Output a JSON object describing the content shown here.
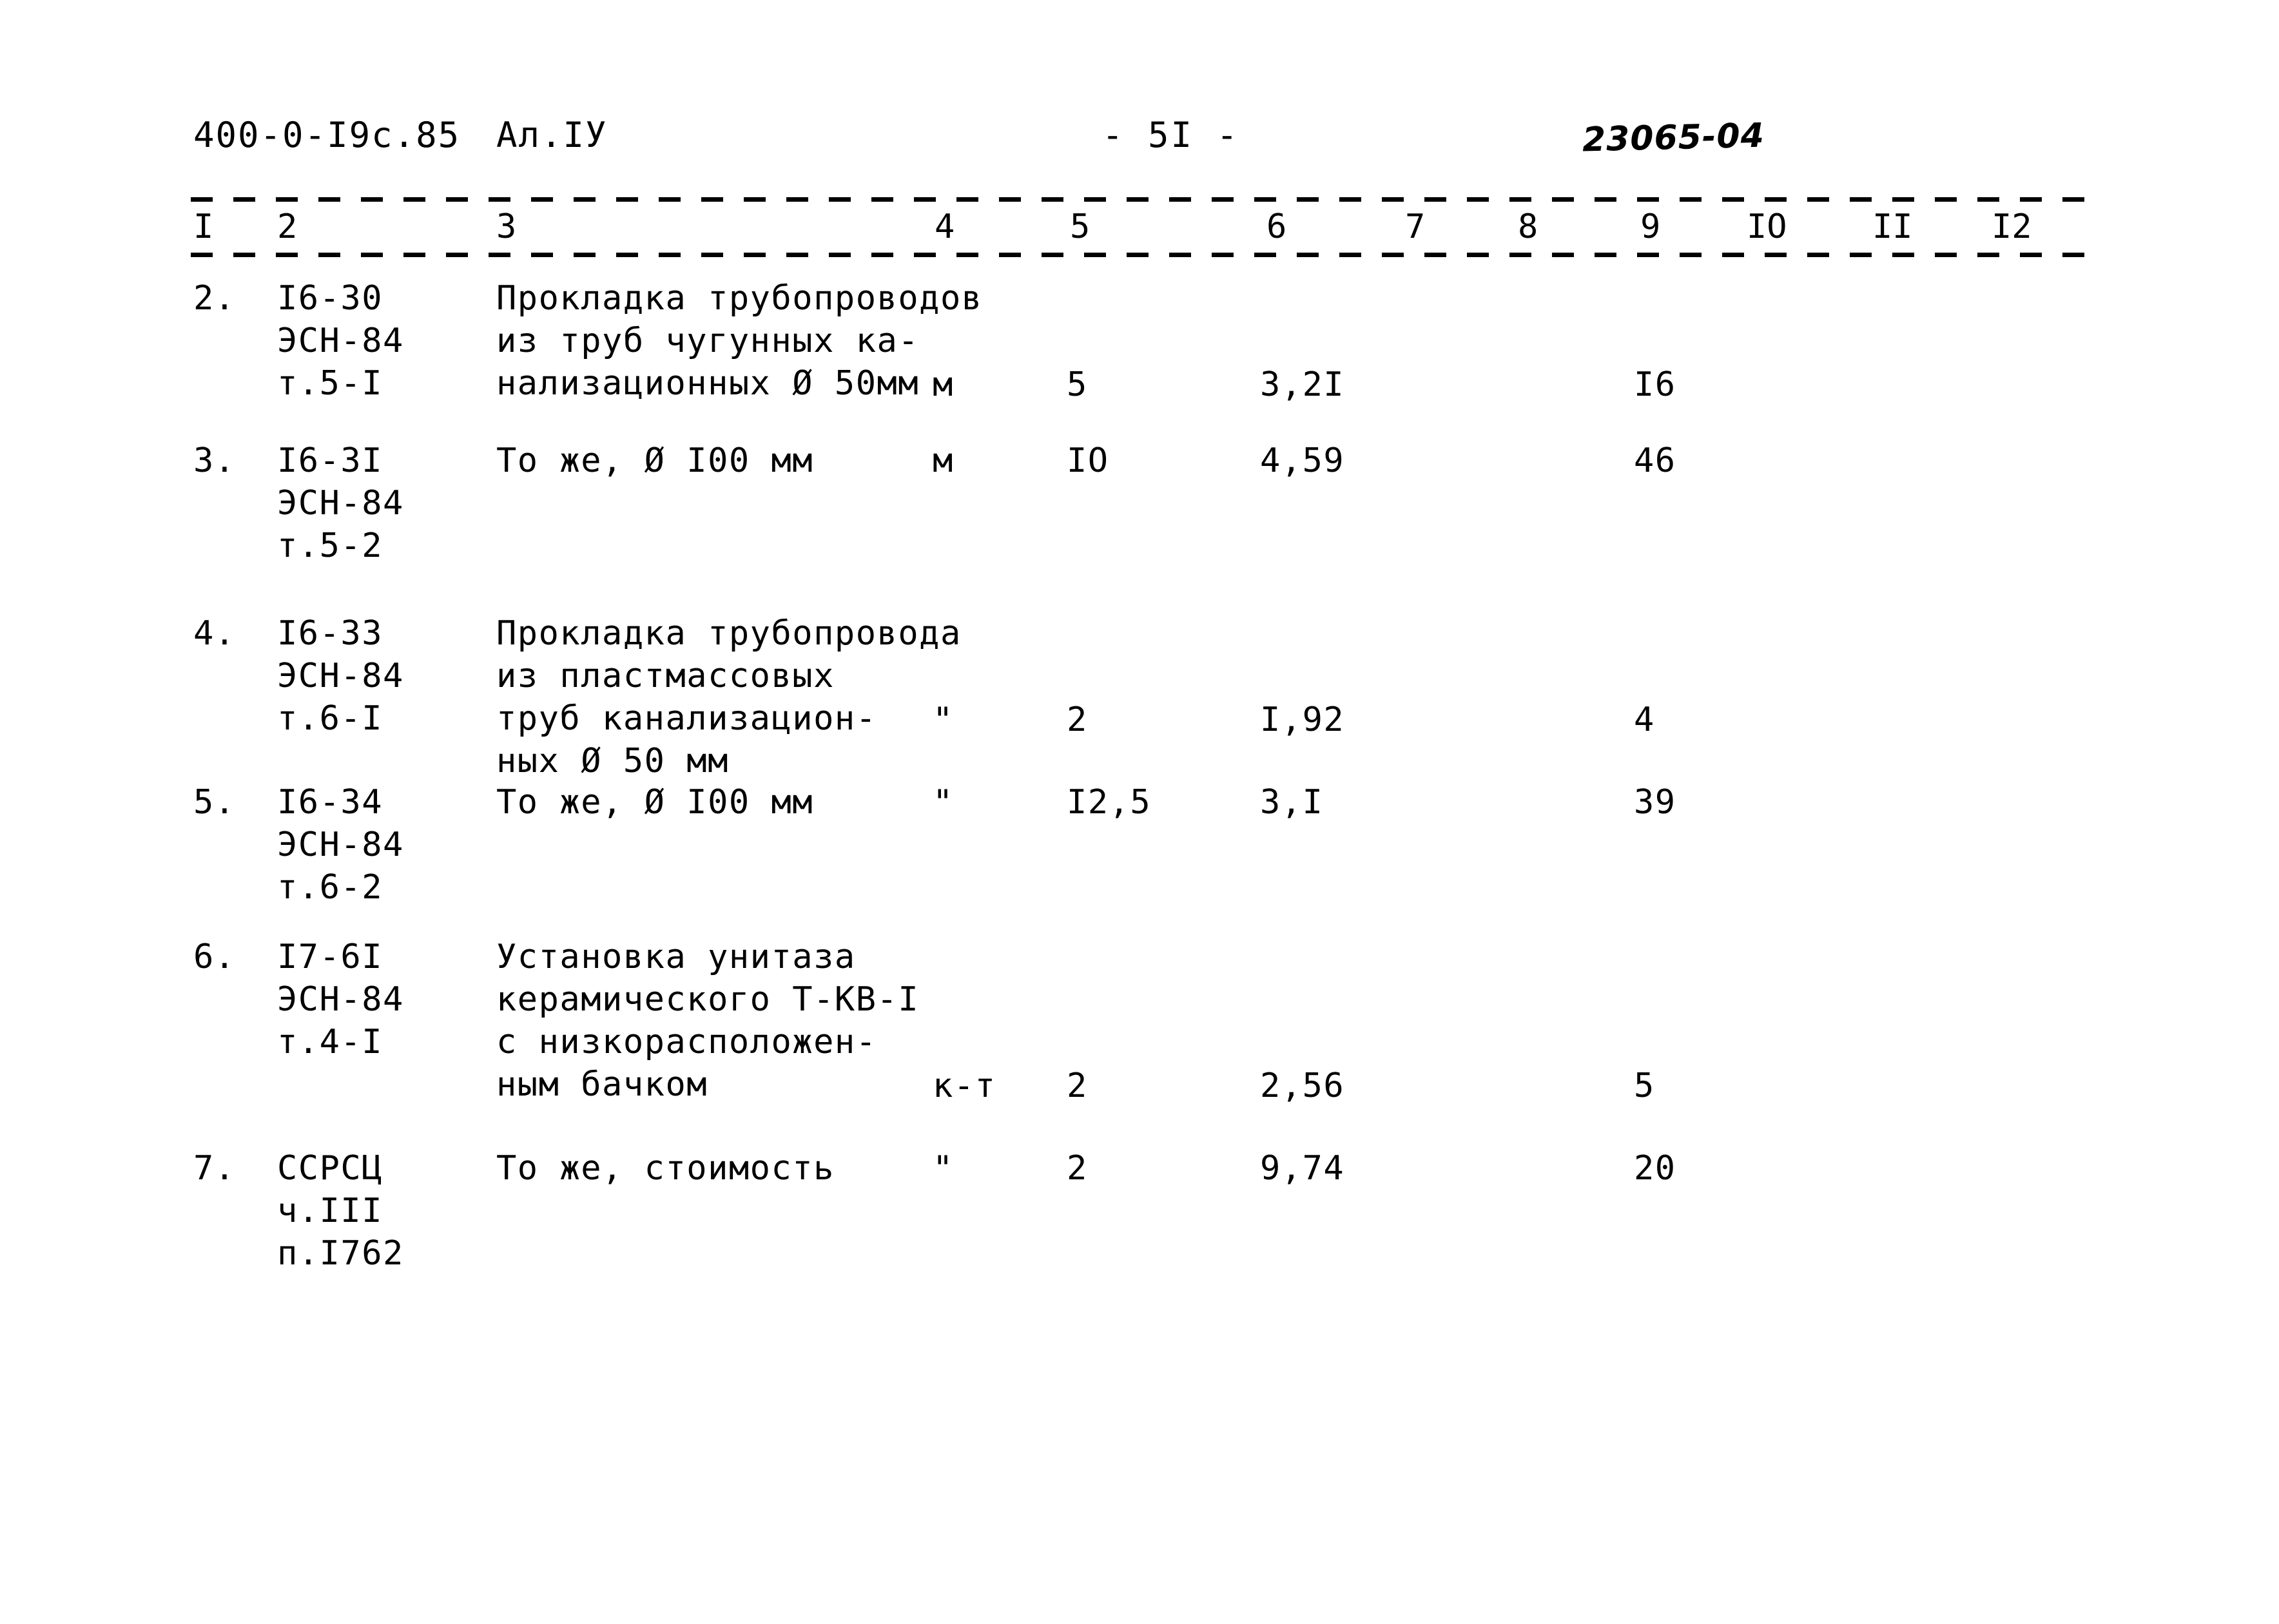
{
  "header": {
    "doc_code": "400-0-I9c.85",
    "album_label": "Ал.IУ",
    "page_number": "- 5I -",
    "hand_written_code": "23065-04"
  },
  "table": {
    "column_numbers": [
      "I",
      "2",
      "3",
      "4",
      "5",
      "6",
      "7",
      "8",
      "9",
      "IO",
      "II",
      "I2"
    ],
    "rows": [
      {
        "num": "2.",
        "justification": [
          "I6-30",
          "ЭСН-84",
          "т.5-I"
        ],
        "description": [
          "Прокладка трубопроводов",
          "из труб чугунных ка-",
          "нализационных Ø 50мм"
        ],
        "unit": "м",
        "quantity": "5",
        "price": "3,2I",
        "total": "I6"
      },
      {
        "num": "3.",
        "justification": [
          "I6-3I",
          "ЭСН-84",
          "т.5-2"
        ],
        "description": [
          "То же, Ø I00 мм"
        ],
        "unit": "м",
        "quantity": "IO",
        "price": "4,59",
        "total": "46"
      },
      {
        "num": "4.",
        "justification": [
          "I6-33",
          "ЭСН-84",
          "т.6-I"
        ],
        "description": [
          "Прокладка трубопровода",
          "из пластмассовых",
          "труб канализацион-",
          "ных Ø 50 мм"
        ],
        "unit": "\"",
        "quantity": "2",
        "price": "I,92",
        "total": "4"
      },
      {
        "num": "5.",
        "justification": [
          "I6-34",
          "ЭСН-84",
          "т.6-2"
        ],
        "description": [
          "То же, Ø I00 мм"
        ],
        "unit": "\"",
        "quantity": "I2,5",
        "price": "3,I",
        "total": "39"
      },
      {
        "num": "6.",
        "justification": [
          "I7-6I",
          "ЭСН-84",
          "т.4-I"
        ],
        "description": [
          "Установка унитаза",
          "керамического Т-КВ-I",
          "с низкорасположен-",
          "ным бачком"
        ],
        "unit": "к-т",
        "quantity": "2",
        "price": "2,56",
        "total": "5"
      },
      {
        "num": "7.",
        "justification": [
          "ССРСЦ",
          "ч.III",
          "п.I762"
        ],
        "description": [
          "То же, стоимость"
        ],
        "unit": "\"",
        "quantity": "2",
        "price": "9,74",
        "total": "20"
      }
    ]
  }
}
